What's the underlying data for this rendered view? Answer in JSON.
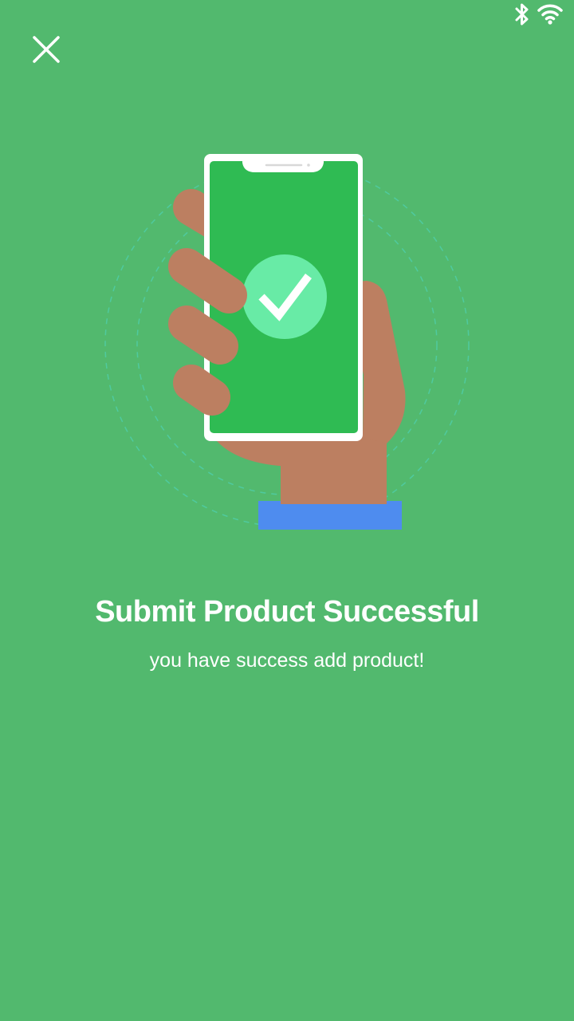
{
  "status_bar": {
    "icons": [
      "bluetooth-icon",
      "wifi-icon"
    ]
  },
  "toolbar": {
    "close_icon": "close-icon"
  },
  "illustration": {
    "name": "hand-holding-phone-with-checkmark"
  },
  "content": {
    "title": "Submit Product Successful",
    "subtitle": "you have success add product!"
  },
  "colors": {
    "background": "#52b96e",
    "phone_screen": "#2fbb53",
    "check_circle": "#68eba6",
    "hand": "#bc7f61",
    "sleeve": "#4e8cef",
    "text": "#ffffff"
  }
}
